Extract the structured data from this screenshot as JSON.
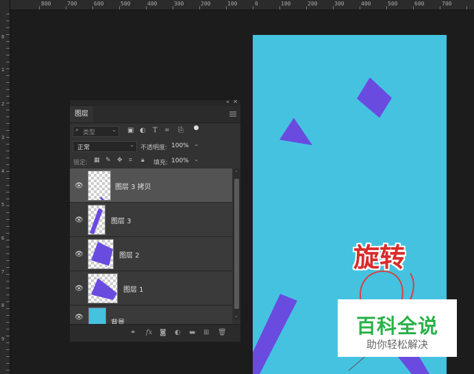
{
  "ruler": {
    "top_labels": [
      "800",
      "700",
      "600",
      "500",
      "400",
      "300",
      "200",
      "100",
      "0",
      "100",
      "200",
      "300",
      "400",
      "500",
      "600",
      "700"
    ],
    "left_labels": [
      "0",
      "1",
      "2",
      "3",
      "4",
      "5",
      "6",
      "7",
      "8",
      "9"
    ]
  },
  "layers_panel": {
    "tab_label": "图层",
    "filter_kind": "类型",
    "blend_mode": "正常",
    "opacity_label": "不透明度:",
    "opacity_value": "100%",
    "lock_label": "锁定:",
    "fill_label": "填充:",
    "fill_value": "100%",
    "layers": [
      {
        "name": "图层 3 拷贝",
        "selected": true
      },
      {
        "name": "图层 3",
        "selected": false
      },
      {
        "name": "图层 2",
        "selected": false
      },
      {
        "name": "图层 1",
        "selected": false
      },
      {
        "name": "背景",
        "selected": false
      }
    ],
    "bottom_icons": [
      "link-icon",
      "fx-icon",
      "mask-icon",
      "adjustment-icon",
      "folder-icon",
      "new-layer-icon",
      "trash-icon"
    ]
  },
  "canvas": {
    "background_color": "#45c2e0",
    "shape_color": "#6a4be0",
    "annotation_text": "旋转"
  },
  "watermark": {
    "title": "百科全说",
    "subtitle": "助你轻松解决"
  }
}
